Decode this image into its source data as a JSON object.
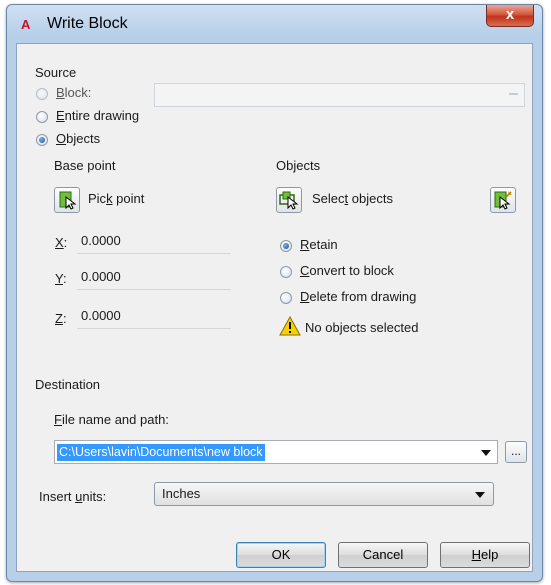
{
  "window": {
    "app_icon": "A",
    "title": "Write Block",
    "close_glyph": "x"
  },
  "source": {
    "label": "Source",
    "options": [
      {
        "key": "B",
        "rest": "lock:",
        "checked": false
      },
      {
        "key": "E",
        "rest": "ntire drawing",
        "checked": false
      },
      {
        "key": "O",
        "rest": "bjects",
        "checked": true
      }
    ],
    "block_value": ""
  },
  "base_point": {
    "label": "Base point",
    "pick_label_pre": "Pic",
    "pick_label_key": "k",
    "pick_label_post": " point",
    "x_key": "X",
    "x_value": "0.0000",
    "y_key": "Y",
    "y_value": "0.0000",
    "z_key": "Z",
    "z_value": "0.0000"
  },
  "objects": {
    "label": "Objects",
    "select_label_pre": "Selec",
    "select_label_key": "t",
    "select_label_post": " objects",
    "options": [
      {
        "key": "R",
        "rest": "etain",
        "checked": true
      },
      {
        "key": "C",
        "rest": "onvert to block",
        "checked": false
      },
      {
        "key": "D",
        "rest": "elete from drawing",
        "checked": false
      }
    ],
    "status": "No objects selected"
  },
  "destination": {
    "label": "Destination",
    "file_label_key": "F",
    "file_label_rest": "ile name and path:",
    "file_value": "C:\\Users\\lavin\\Documents\\new block",
    "browse_label": "...",
    "units_label_pre": "Insert ",
    "units_label_key": "u",
    "units_label_post": "nits:",
    "units_value": "Inches"
  },
  "buttons": {
    "ok": "OK",
    "cancel": "Cancel",
    "help_key": "H",
    "help_rest": "elp"
  },
  "colors": {
    "selection": "#3399ff",
    "warning": "#f5d200"
  }
}
